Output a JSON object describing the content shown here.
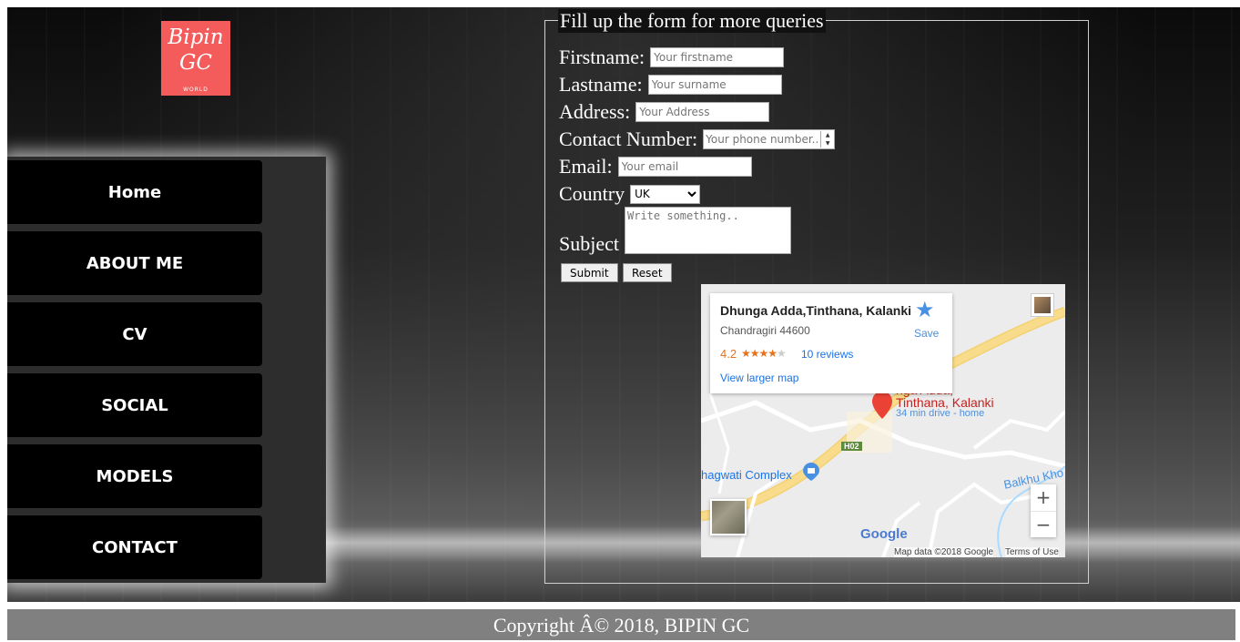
{
  "logo": {
    "line1": "Bipin",
    "line2": "GC",
    "line3": "WORLD"
  },
  "nav": {
    "items": [
      {
        "label": "Home"
      },
      {
        "label": "ABOUT ME"
      },
      {
        "label": "CV"
      },
      {
        "label": "SOCIAL"
      },
      {
        "label": "MODELS"
      },
      {
        "label": "CONTACT"
      }
    ]
  },
  "form": {
    "legend": "Fill up the form for more queries",
    "firstname": {
      "label": "Firstname:",
      "placeholder": "Your firstname"
    },
    "lastname": {
      "label": "Lastname:",
      "placeholder": "Your surname"
    },
    "address": {
      "label": "Address:",
      "placeholder": "Your Address"
    },
    "contact": {
      "label": "Contact Number:",
      "placeholder": "Your phone number.."
    },
    "email": {
      "label": "Email:",
      "placeholder": "Your email"
    },
    "country": {
      "label": "Country",
      "selected": "UK"
    },
    "subject": {
      "label": "Subject",
      "placeholder": "Write something.."
    },
    "submit_label": "Submit",
    "reset_label": "Reset"
  },
  "map": {
    "place_name": "Dhunga Adda,Tinthana, Kalanki",
    "address": "Chandragiri 44600",
    "rating": "4.2",
    "stars_on": "★★★★",
    "stars_off": "★",
    "reviews": "10 reviews",
    "view_larger": "View larger map",
    "save_label": "Save",
    "pin_label_1": "nga Adda,",
    "pin_label_2": "Tinthana, Kalanki",
    "drive_time": "34 min drive - home",
    "road_badge": "H02",
    "poi_1": "hagwati Complex",
    "poi_2": "Balkhu Kho",
    "google_logo": "Google",
    "map_data": "Map data ©2018 Google",
    "terms": "Terms of Use",
    "zoom_in": "+",
    "zoom_out": "−",
    "colors": {
      "road": "#f9dc8b",
      "pin": "#ea4335",
      "link": "#1a73e8",
      "rating": "#e7711b"
    }
  },
  "footer": {
    "text": "Copyright Â© 2018, BIPIN GC"
  }
}
